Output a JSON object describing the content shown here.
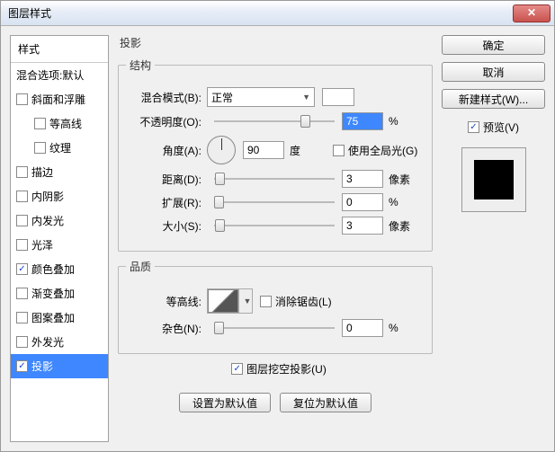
{
  "dialog": {
    "title": "图层样式"
  },
  "sidebar": {
    "header": "样式",
    "blend_options": "混合选项:默认",
    "items": [
      {
        "label": "斜面和浮雕",
        "checked": false
      },
      {
        "label": "等高线",
        "checked": false,
        "sub": true
      },
      {
        "label": "纹理",
        "checked": false,
        "sub": true
      },
      {
        "label": "描边",
        "checked": false
      },
      {
        "label": "内阴影",
        "checked": false
      },
      {
        "label": "内发光",
        "checked": false
      },
      {
        "label": "光泽",
        "checked": false
      },
      {
        "label": "颜色叠加",
        "checked": true
      },
      {
        "label": "渐变叠加",
        "checked": false
      },
      {
        "label": "图案叠加",
        "checked": false
      },
      {
        "label": "外发光",
        "checked": false
      },
      {
        "label": "投影",
        "checked": true,
        "selected": true
      }
    ]
  },
  "center": {
    "title": "投影",
    "structure": {
      "legend": "结构",
      "blend_mode_label": "混合模式(B):",
      "blend_mode_value": "正常",
      "opacity_label": "不透明度(O):",
      "opacity_value": "75",
      "opacity_unit": "%",
      "angle_label": "角度(A):",
      "angle_value": "90",
      "angle_unit": "度",
      "global_light_label": "使用全局光(G)",
      "distance_label": "距离(D):",
      "distance_value": "3",
      "distance_unit": "像素",
      "spread_label": "扩展(R):",
      "spread_value": "0",
      "spread_unit": "%",
      "size_label": "大小(S):",
      "size_value": "3",
      "size_unit": "像素"
    },
    "quality": {
      "legend": "品质",
      "contour_label": "等高线:",
      "antialiased_label": "消除锯齿(L)",
      "noise_label": "杂色(N):",
      "noise_value": "0",
      "noise_unit": "%"
    },
    "knockout_label": "图层挖空投影(U)",
    "make_default": "设置为默认值",
    "reset_default": "复位为默认值"
  },
  "right": {
    "ok": "确定",
    "cancel": "取消",
    "new_style": "新建样式(W)...",
    "preview": "预览(V)"
  }
}
